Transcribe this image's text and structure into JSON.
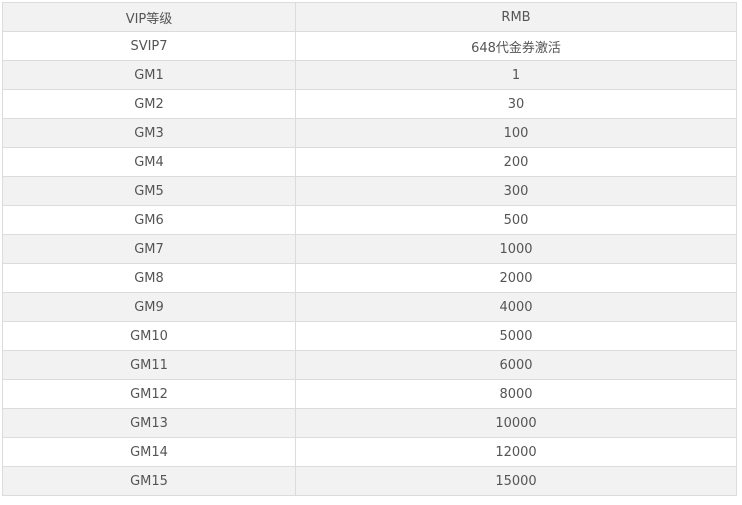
{
  "table": {
    "headers": [
      "VIP等级",
      "RMB"
    ],
    "rows": [
      [
        "SVIP7",
        "648代金券激活"
      ],
      [
        "GM1",
        "1"
      ],
      [
        "GM2",
        "30"
      ],
      [
        "GM3",
        "100"
      ],
      [
        "GM4",
        "200"
      ],
      [
        "GM5",
        "300"
      ],
      [
        "GM6",
        "500"
      ],
      [
        "GM7",
        "1000"
      ],
      [
        "GM8",
        "2000"
      ],
      [
        "GM9",
        "4000"
      ],
      [
        "GM10",
        "5000"
      ],
      [
        "GM11",
        "6000"
      ],
      [
        "GM12",
        "8000"
      ],
      [
        "GM13",
        "10000"
      ],
      [
        "GM14",
        "12000"
      ],
      [
        "GM15",
        "15000"
      ]
    ]
  }
}
